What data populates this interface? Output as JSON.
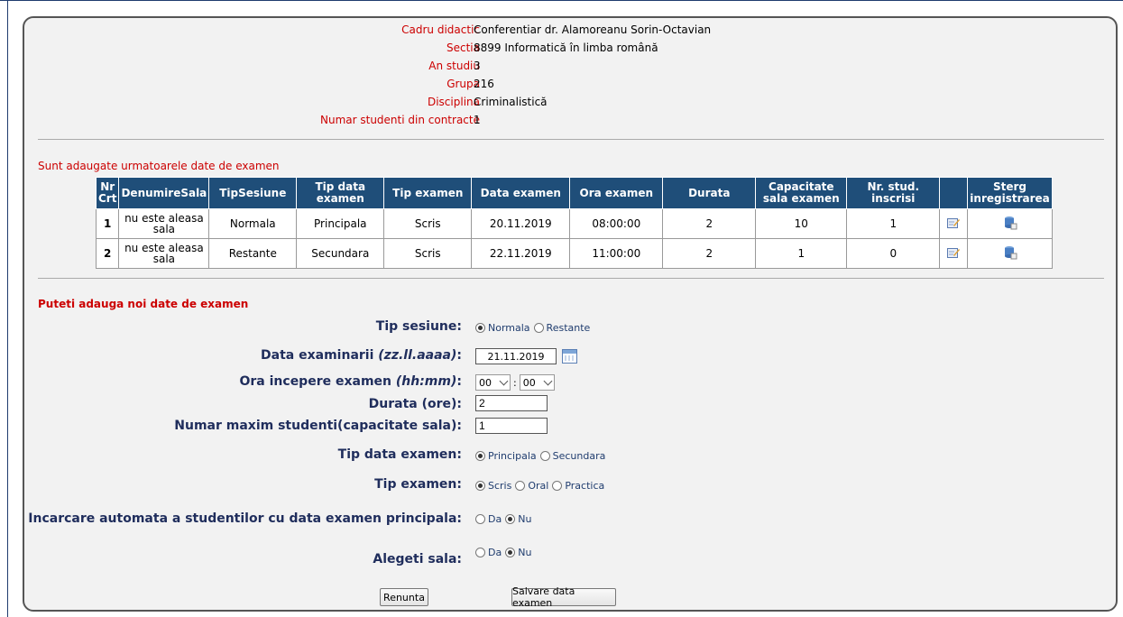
{
  "header": {
    "rows": [
      {
        "label": "Cadru didactic",
        "value": "Conferentiar dr. Alamoreanu Sorin-Octavian"
      },
      {
        "label": "Sectia",
        "value": "8899 Informatică în limba română"
      },
      {
        "label": "An studiu",
        "value": "3"
      },
      {
        "label": "Grupa",
        "value": "216"
      },
      {
        "label": "Disciplina",
        "value": "Criminalistică"
      },
      {
        "label": "Numar studenti din contracte",
        "value": "1"
      }
    ]
  },
  "exam_list": {
    "title": "Sunt adaugate urmatoarele date de examen",
    "columns": [
      "Nr Crt",
      "DenumireSala",
      "TipSesiune",
      "Tip data examen",
      "Tip examen",
      "Data examen",
      "Ora examen",
      "Durata",
      "Capacitate sala examen",
      "Nr. stud. inscrisi",
      "",
      "Sterg inregistrarea"
    ],
    "rows": [
      {
        "nr": "1",
        "sala": "nu este aleasa sala",
        "sesiune": "Normala",
        "tip_data": "Principala",
        "tip_examen": "Scris",
        "data": "20.11.2019",
        "ora": "08:00:00",
        "durata": "2",
        "capacitate": "10",
        "inscrisi": "1"
      },
      {
        "nr": "2",
        "sala": "nu este aleasa sala",
        "sesiune": "Restante",
        "tip_data": "Secundara",
        "tip_examen": "Scris",
        "data": "22.11.2019",
        "ora": "11:00:00",
        "durata": "2",
        "capacitate": "1",
        "inscrisi": "0"
      }
    ],
    "icons": {
      "edit": "edit-icon",
      "delete": "delete-icon"
    }
  },
  "form": {
    "title": "Puteti adauga noi date de examen",
    "tip_sesiune": {
      "label": "Tip sesiune:",
      "options": [
        "Normala",
        "Restante"
      ],
      "selected": "Normala"
    },
    "data_examinarii": {
      "label": "Data examinarii",
      "hint": "(zz.ll.aaaa)",
      "colon": ":",
      "value": "21.11.2019"
    },
    "ora_incepere": {
      "label": "Ora incepere examen",
      "hint": "(hh:mm)",
      "colon": ":",
      "hour": "00",
      "minute": "00",
      "sep": ":"
    },
    "durata": {
      "label": "Durata (ore):",
      "value": "2"
    },
    "numar_maxim": {
      "label": "Numar maxim studenti(capacitate sala):",
      "value": "1"
    },
    "tip_data_examen": {
      "label": "Tip data examen:",
      "options": [
        "Principala",
        "Secundara"
      ],
      "selected": "Principala"
    },
    "tip_examen": {
      "label": "Tip examen:",
      "options": [
        "Scris",
        "Oral",
        "Practica"
      ],
      "selected": "Scris"
    },
    "incarcare": {
      "label": "Incarcare automata a studentilor cu data examen principala:",
      "options": [
        "Da",
        "Nu"
      ],
      "selected": "Nu"
    },
    "alegeti_sala": {
      "label": "Alegeti sala:",
      "options": [
        "Da",
        "Nu"
      ],
      "selected": "Nu"
    },
    "buttons": {
      "cancel": "Renunta",
      "save": "Salvare data examen"
    }
  },
  "colors": {
    "header_bg": "#1f4e79",
    "label_red": "#cc0000",
    "form_label": "#1f2d5c"
  }
}
